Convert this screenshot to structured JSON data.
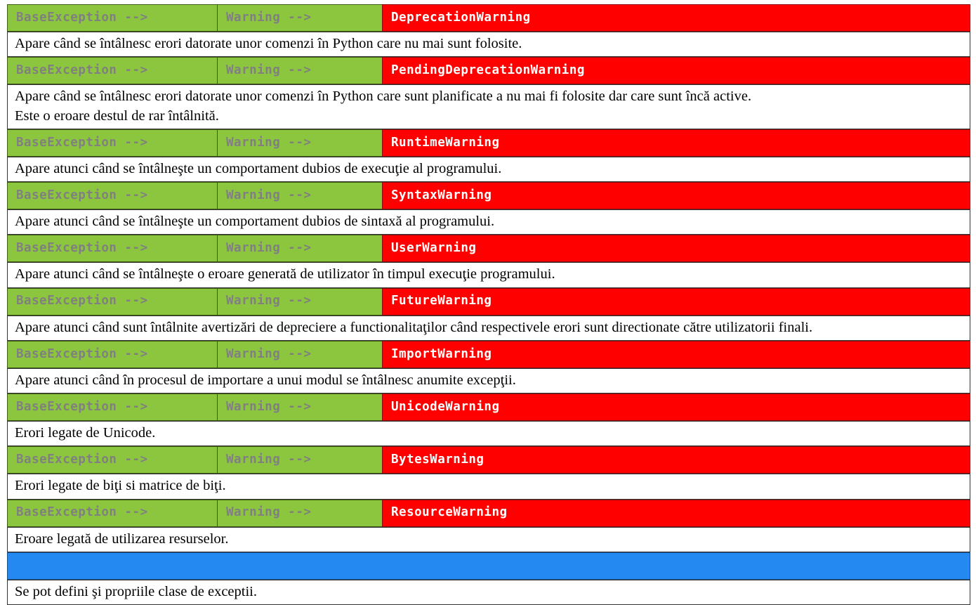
{
  "page": {
    "language": "ro",
    "colors": {
      "chain_green": "#8CC63F",
      "chain_green_text": "#808080",
      "leaf_red": "#FF0000",
      "leaf_red_text": "#FFFFFF",
      "blue_bar": "#2589F2",
      "description_text": "#000000",
      "description_background": "#FFFFFF"
    }
  },
  "table": {
    "rows": [
      {
        "base": "BaseException -->",
        "mid": "Warning -->",
        "leaf": "DeprecationWarning",
        "description": "Apare când se întâlnesc erori datorate unor comenzi în Python care nu mai sunt folosite."
      },
      {
        "base": "BaseException -->",
        "mid": "Warning -->",
        "leaf": "PendingDeprecationWarning",
        "description": "Apare când se întâlnesc erori datorate unor comenzi în Python care sunt planificate a nu mai fi folosite dar care sunt încă active.\nEste o eroare destul de rar întâlnită."
      },
      {
        "base": "BaseException -->",
        "mid": "Warning -->",
        "leaf": "RuntimeWarning",
        "description": "Apare atunci când se întâlneşte un comportament dubios de execuţie al programului."
      },
      {
        "base": "BaseException -->",
        "mid": "Warning -->",
        "leaf": "SyntaxWarning",
        "description": "Apare atunci când se întâlneşte un comportament dubios de sintaxă al programului."
      },
      {
        "base": "BaseException -->",
        "mid": "Warning -->",
        "leaf": "UserWarning",
        "description": "Apare atunci când se întâlneşte o eroare generată de utilizator în timpul execuţie programului."
      },
      {
        "base": "BaseException -->",
        "mid": "Warning -->",
        "leaf": "FutureWarning",
        "description": "Apare atunci când sunt întâlnite avertizări de depreciere a functionalitaţilor când respectivele erori sunt directionate către utilizatorii finali."
      },
      {
        "base": "BaseException -->",
        "mid": "Warning -->",
        "leaf": "ImportWarning",
        "description": "Apare atunci când în procesul de importare a unui modul se întâlnesc anumite excepţii."
      },
      {
        "base": "BaseException -->",
        "mid": "Warning -->",
        "leaf": "UnicodeWarning",
        "description": "Erori legate de Unicode."
      },
      {
        "base": "BaseException -->",
        "mid": "Warning -->",
        "leaf": "BytesWarning",
        "description": "Erori legate de biţi si matrice de biţi."
      },
      {
        "base": "BaseException -->",
        "mid": "Warning -->",
        "leaf": "ResourceWarning",
        "description": "Eroare legată de utilizarea resurselor."
      }
    ],
    "footer": {
      "bar_label": "",
      "description": "Se pot defini şi propriile clase de exceptii."
    }
  }
}
